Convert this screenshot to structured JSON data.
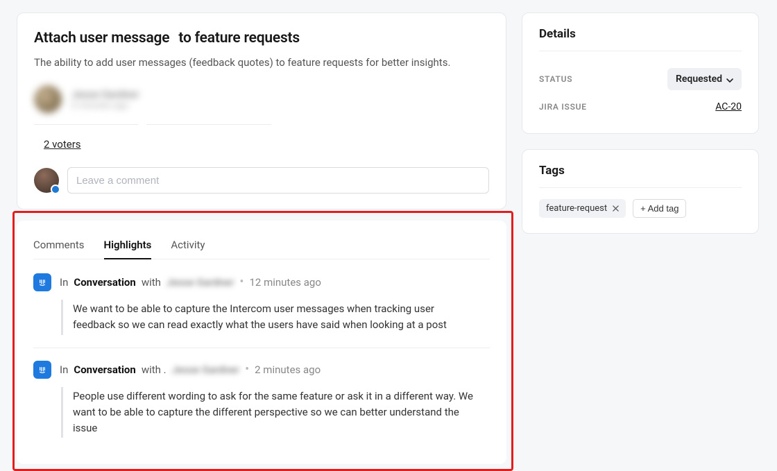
{
  "post": {
    "title_a": "Attach user message",
    "title_b": "to feature requests",
    "description": "The ability to add user messages (feedback quotes) to feature requests for better insights.",
    "author": {
      "name": "Jesse Gardner",
      "time": "6 minutes ago"
    },
    "voters_link": "2 voters",
    "comment_placeholder": "Leave a comment"
  },
  "tabs": {
    "comments": "Comments",
    "highlights": "Highlights",
    "activity": "Activity",
    "active": "highlights"
  },
  "highlights": [
    {
      "in": "In",
      "conversation": "Conversation",
      "with": "with",
      "name": "Jesse Gardner",
      "time": "12 minutes ago",
      "quote": "We want to be able to capture the Intercom user messages when tracking user feedback so we can read exactly what the users have said when looking at a post"
    },
    {
      "in": "In",
      "conversation": "Conversation",
      "with": "with .",
      "name": "Jesse Gardner",
      "time": "2 minutes ago",
      "quote": "People use different wording to ask for the same feature or ask it in a different way. We want to be able to capture the different perspective so we can better understand the issue"
    }
  ],
  "sidebar": {
    "details": {
      "title": "Details",
      "status_label": "STATUS",
      "status_value": "Requested",
      "jira_label": "JIRA ISSUE",
      "jira_value": "AC-20"
    },
    "tags": {
      "title": "Tags",
      "items": [
        "feature-request"
      ],
      "add_label": "+ Add tag"
    }
  }
}
